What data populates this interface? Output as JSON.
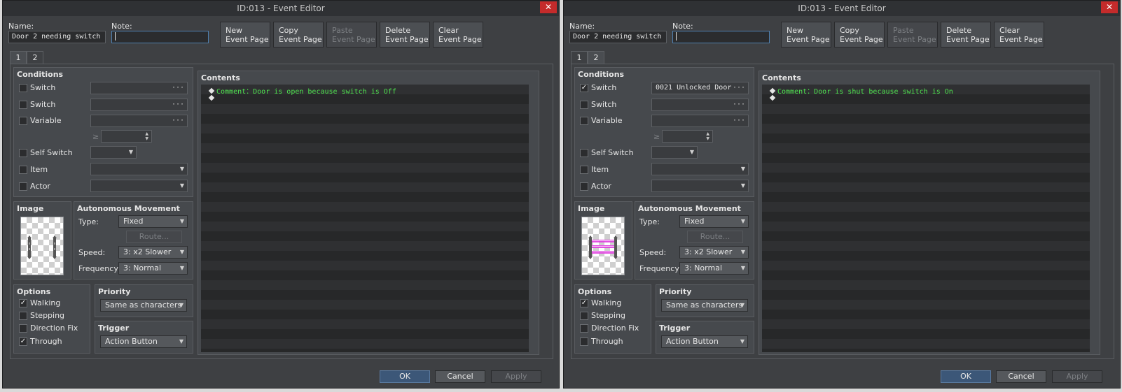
{
  "windows": [
    {
      "title": "ID:013 - Event Editor",
      "close_glyph": "✕",
      "name_label": "Name:",
      "name_value": "Door 2 needing switch",
      "note_label": "Note:",
      "note_value": "",
      "buttons": {
        "new_page": "New\nEvent Page",
        "copy_page": "Copy\nEvent Page",
        "paste_page": "Paste\nEvent Page",
        "delete_page": "Delete\nEvent Page",
        "clear_page": "Clear\nEvent Page"
      },
      "tabs": [
        "1",
        "2"
      ],
      "active_tab": 0,
      "conditions": {
        "title": "Conditions",
        "switch1": {
          "label": "Switch",
          "checked": "",
          "value": ""
        },
        "switch2": {
          "label": "Switch",
          "checked": "",
          "value": ""
        },
        "variable": {
          "label": "Variable",
          "checked": "",
          "value": ""
        },
        "gte": "≥",
        "self_switch": {
          "label": "Self Switch",
          "checked": ""
        },
        "item": {
          "label": "Item",
          "checked": ""
        },
        "actor": {
          "label": "Actor",
          "checked": ""
        }
      },
      "image": {
        "title": "Image",
        "sprite": "closed-door-sprite"
      },
      "movement": {
        "title": "Autonomous Movement",
        "type_label": "Type:",
        "type_value": "Fixed",
        "route_label": "Route...",
        "speed_label": "Speed:",
        "speed_value": "3: x2 Slower",
        "frequency_label": "Frequency:",
        "frequency_value": "3: Normal"
      },
      "options": {
        "title": "Options",
        "walking": {
          "label": "Walking",
          "checked": "✓"
        },
        "stepping": {
          "label": "Stepping",
          "checked": ""
        },
        "direction_fix": {
          "label": "Direction Fix",
          "checked": ""
        },
        "through": {
          "label": "Through",
          "checked": "✓"
        }
      },
      "priority": {
        "title": "Priority",
        "value": "Same as characters"
      },
      "trigger": {
        "title": "Trigger",
        "value": "Action Button"
      },
      "contents": {
        "title": "Contents",
        "rows": [
          "Comment：Door is open because switch is Off",
          ""
        ]
      },
      "footer": {
        "ok": "OK",
        "cancel": "Cancel",
        "apply": "Apply"
      }
    },
    {
      "title": "ID:013 - Event Editor",
      "close_glyph": "✕",
      "name_label": "Name:",
      "name_value": "Door 2 needing switch",
      "note_label": "Note:",
      "note_value": "",
      "buttons": {
        "new_page": "New\nEvent Page",
        "copy_page": "Copy\nEvent Page",
        "paste_page": "Paste\nEvent Page",
        "delete_page": "Delete\nEvent Page",
        "clear_page": "Clear\nEvent Page"
      },
      "tabs": [
        "1",
        "2"
      ],
      "active_tab": 1,
      "conditions": {
        "title": "Conditions",
        "switch1": {
          "label": "Switch",
          "checked": "✓",
          "value": "0021 Unlocked Door"
        },
        "switch2": {
          "label": "Switch",
          "checked": "",
          "value": ""
        },
        "variable": {
          "label": "Variable",
          "checked": "",
          "value": ""
        },
        "gte": "≥",
        "self_switch": {
          "label": "Self Switch",
          "checked": ""
        },
        "item": {
          "label": "Item",
          "checked": ""
        },
        "actor": {
          "label": "Actor",
          "checked": ""
        }
      },
      "image": {
        "title": "Image",
        "sprite": "laser-barrier-sprite"
      },
      "movement": {
        "title": "Autonomous Movement",
        "type_label": "Type:",
        "type_value": "Fixed",
        "route_label": "Route...",
        "speed_label": "Speed:",
        "speed_value": "3: x2 Slower",
        "frequency_label": "Frequency:",
        "frequency_value": "3: Normal"
      },
      "options": {
        "title": "Options",
        "walking": {
          "label": "Walking",
          "checked": "✓"
        },
        "stepping": {
          "label": "Stepping",
          "checked": ""
        },
        "direction_fix": {
          "label": "Direction Fix",
          "checked": ""
        },
        "through": {
          "label": "Through",
          "checked": ""
        }
      },
      "priority": {
        "title": "Priority",
        "value": "Same as characters"
      },
      "trigger": {
        "title": "Trigger",
        "value": "Action Button"
      },
      "contents": {
        "title": "Contents",
        "rows": [
          "Comment：Door is shut because switch is On",
          ""
        ]
      },
      "footer": {
        "ok": "OK",
        "cancel": "Cancel",
        "apply": "Apply"
      }
    }
  ],
  "icons": {
    "close": "close-icon",
    "ellipsis": "ellipsis-icon",
    "dropdown": "chevron-down-icon",
    "spinner": "spinner-icon",
    "list_marker": "diamond-icon"
  },
  "colors": {
    "window_bg": "#3e4043",
    "title_bar": "#2f3134",
    "close_red": "#c42b2b",
    "comment_green": "#4ee04e",
    "ok_blue": "#3c5778",
    "laser_magenta": "#e040e0"
  }
}
